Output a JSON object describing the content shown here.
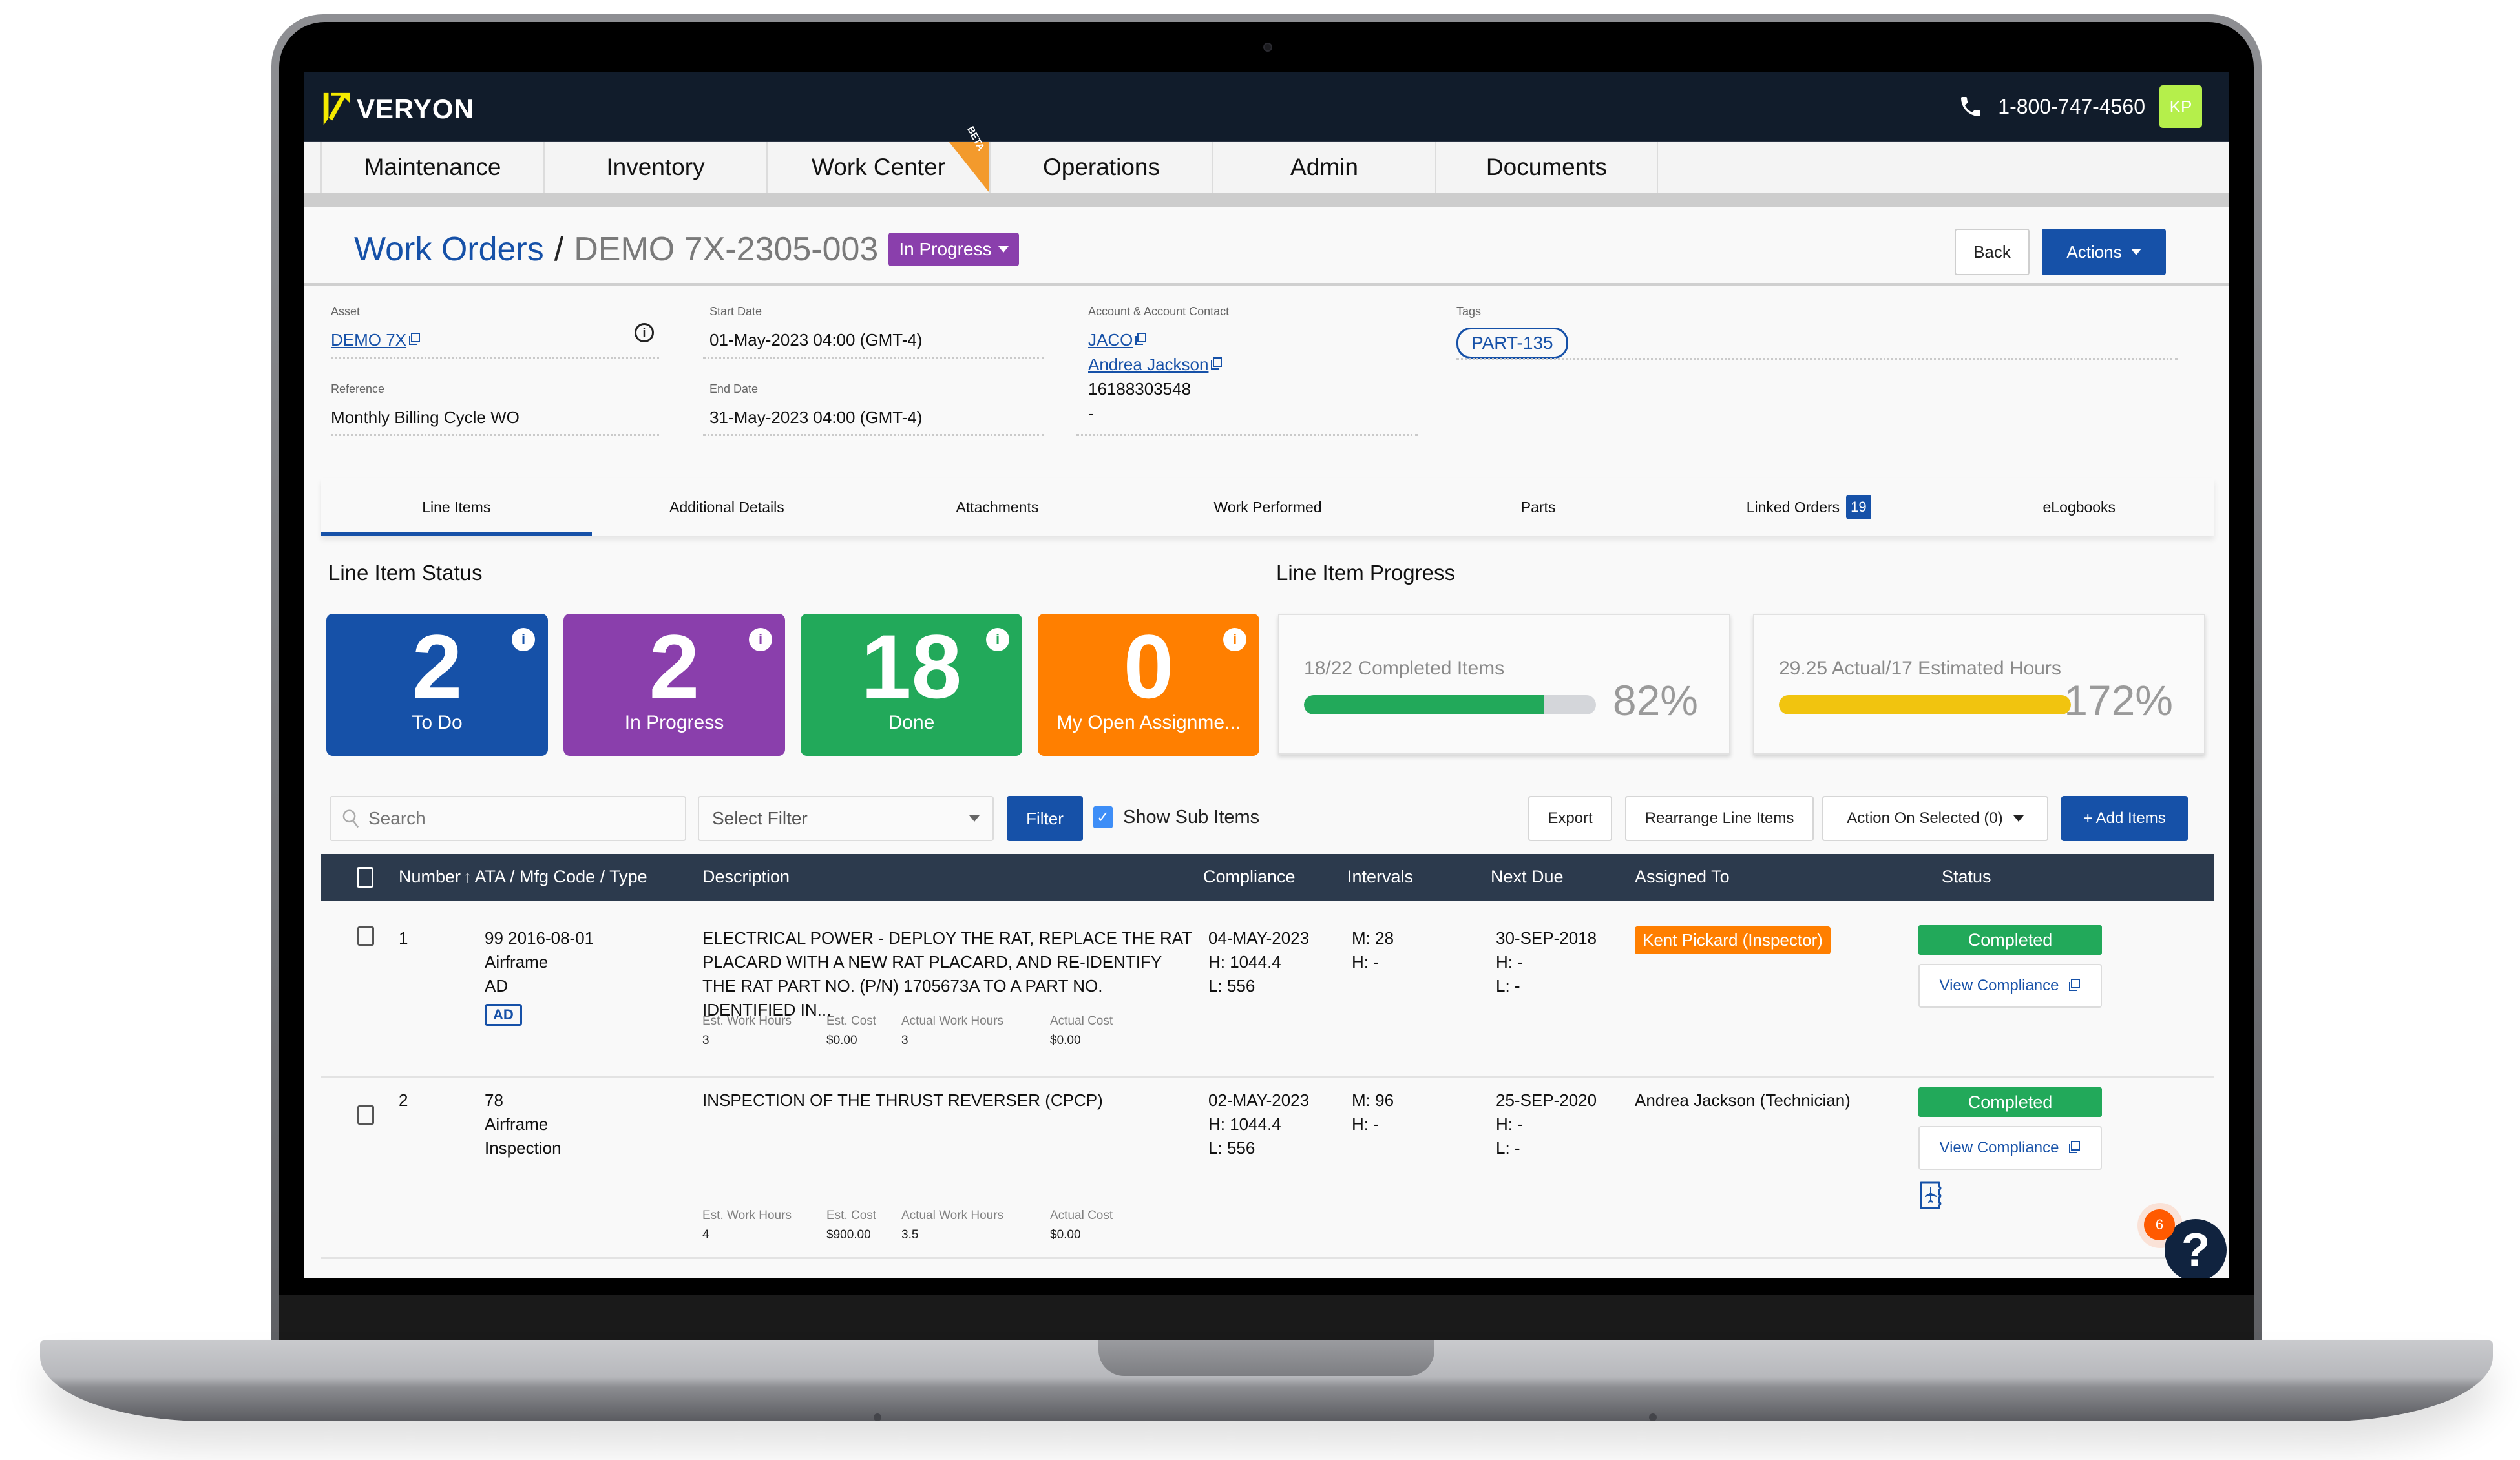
{
  "app": {
    "brand": "VERYON",
    "phone": "1-800-747-4560",
    "user_initials": "KP",
    "colors": {
      "header_bg": "#111c2b",
      "primary": "#1651a8",
      "status_in_progress": "#8a3fac",
      "todo": "#1651a8",
      "in_progress": "#8a3fac",
      "done": "#22a95a",
      "my_open": "#ff7f00",
      "avatar": "#b5ef4b",
      "progress_green": "#22a95a",
      "progress_yellow": "#f1c40f"
    }
  },
  "nav": {
    "items": [
      {
        "label": "Maintenance"
      },
      {
        "label": "Inventory"
      },
      {
        "label": "Work Center",
        "badge": "BETA"
      },
      {
        "label": "Operations"
      },
      {
        "label": "Admin"
      },
      {
        "label": "Documents"
      }
    ]
  },
  "title": {
    "breadcrumb_root": "Work Orders",
    "separator": "/",
    "work_order_id": "DEMO 7X-2305-003",
    "status": "In Progress",
    "back_label": "Back",
    "actions_label": "Actions"
  },
  "details": {
    "asset": {
      "label": "Asset",
      "value": "DEMO 7X"
    },
    "reference": {
      "label": "Reference",
      "value": "Monthly Billing Cycle WO"
    },
    "start_date": {
      "label": "Start Date",
      "value": "01-May-2023 04:00 (GMT-4)"
    },
    "end_date": {
      "label": "End Date",
      "value": "31-May-2023 04:00 (GMT-4)"
    },
    "account": {
      "label": "Account & Account Contact",
      "account": "JACO",
      "contact": "Andrea Jackson",
      "phone": "16188303548",
      "extra": "-"
    },
    "tags": {
      "label": "Tags",
      "items": [
        "PART-135"
      ]
    }
  },
  "tabs": [
    {
      "label": "Line Items",
      "active": true
    },
    {
      "label": "Additional Details"
    },
    {
      "label": "Attachments"
    },
    {
      "label": "Work Performed"
    },
    {
      "label": "Parts"
    },
    {
      "label": "Linked Orders",
      "badge": "19"
    },
    {
      "label": "eLogbooks"
    }
  ],
  "status_section": {
    "title": "Line Item Status",
    "cards": [
      {
        "value": "2",
        "label": "To Do"
      },
      {
        "value": "2",
        "label": "In Progress"
      },
      {
        "value": "18",
        "label": "Done"
      },
      {
        "value": "0",
        "label": "My Open Assignme..."
      }
    ]
  },
  "progress_section": {
    "title": "Line Item Progress",
    "items": [
      {
        "label": "18/22 Completed Items",
        "percent_text": "82%",
        "fill_fraction": 0.82
      },
      {
        "label": "29.25 Actual/17 Estimated Hours",
        "percent_text": "172%",
        "fill_fraction": 1.0
      }
    ]
  },
  "toolbar": {
    "search_placeholder": "Search",
    "select_filter": "Select Filter",
    "filter_label": "Filter",
    "show_sub_items": "Show Sub Items",
    "show_sub_items_checked": true,
    "export_label": "Export",
    "rearrange_label": "Rearrange Line Items",
    "action_on_selected": "Action On Selected (0)",
    "add_items_label": "+ Add Items"
  },
  "table": {
    "columns": {
      "number": "Number",
      "ata": "ATA / Mfg Code / Type",
      "description": "Description",
      "compliance": "Compliance",
      "intervals": "Intervals",
      "next_due": "Next Due",
      "assigned_to": "Assigned To",
      "status": "Status"
    },
    "meta_labels": {
      "est_hours": "Est. Work Hours",
      "est_cost": "Est. Cost",
      "actual_hours": "Actual Work Hours",
      "actual_cost": "Actual Cost"
    },
    "rows": [
      {
        "number": "1",
        "ata": "99 2016-08-01",
        "mfg": "Airframe",
        "type": "AD",
        "type_badge": "AD",
        "description": "ELECTRICAL POWER - DEPLOY THE RAT, REPLACE THE RAT PLACARD WITH A NEW RAT PLACARD, AND RE-IDENTIFY THE RAT PART NO. (P/N) 1705673A TO A PART NO. IDENTIFIED IN...",
        "est_hours": "3",
        "est_cost": "$0.00",
        "actual_hours": "3",
        "actual_cost": "$0.00",
        "compliance": [
          "04-MAY-2023",
          "H: 1044.4",
          "L: 556"
        ],
        "intervals": [
          "M: 28",
          "H: -"
        ],
        "next_due": [
          "30-SEP-2018",
          "H: -",
          "L: -"
        ],
        "assigned_to": "Kent Pickard (Inspector)",
        "assigned_highlight": true,
        "status": "Completed",
        "view_compliance": "View Compliance"
      },
      {
        "number": "2",
        "ata": "78",
        "mfg": "Airframe",
        "type": "Inspection",
        "description": "INSPECTION OF THE THRUST REVERSER (CPCP)",
        "est_hours": "4",
        "est_cost": "$900.00",
        "actual_hours": "3.5",
        "actual_cost": "$0.00",
        "compliance": [
          "02-MAY-2023",
          "H: 1044.4",
          "L: 556"
        ],
        "intervals": [
          "M: 96",
          "H: -"
        ],
        "next_due": [
          "25-SEP-2020",
          "H: -",
          "L: -"
        ],
        "assigned_to": "Andrea Jackson (Technician)",
        "assigned_highlight": false,
        "status": "Completed",
        "view_compliance": "View Compliance",
        "has_logbook_icon": true
      }
    ]
  },
  "help": {
    "symbol": "?",
    "notification_count": "6"
  }
}
